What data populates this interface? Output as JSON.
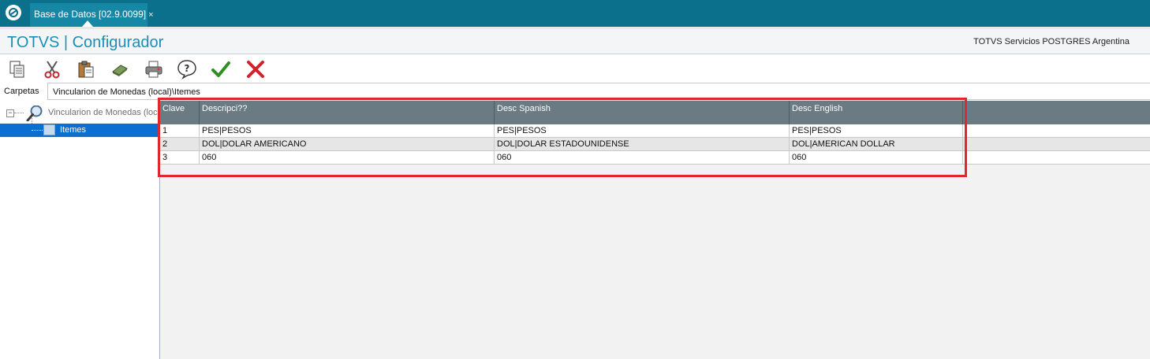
{
  "topbar": {
    "logo_icon": "totvs-logo-icon",
    "tab_label": "Base de Datos [02.9.0099]",
    "tab_close": "×"
  },
  "header": {
    "title": "TOTVS | Configurador",
    "company": "TOTVS Servicios POSTGRES Argentina"
  },
  "toolbar": {
    "buttons": [
      {
        "icon": "copy-icon",
        "glyph": "📄"
      },
      {
        "icon": "cut-icon",
        "glyph": "✂"
      },
      {
        "icon": "paste-icon",
        "glyph": "📋"
      },
      {
        "icon": "eraser-icon",
        "glyph": "▰"
      },
      {
        "icon": "print-icon",
        "glyph": "🖨"
      },
      {
        "icon": "help-icon",
        "glyph": "?"
      },
      {
        "icon": "confirm-icon",
        "glyph": "✔"
      },
      {
        "icon": "cancel-icon",
        "glyph": "✖"
      }
    ]
  },
  "pathbar": {
    "label": "Carpetas",
    "path": "Vincularion de Monedas (local)\\Itemes"
  },
  "tree": {
    "expander": "−",
    "root_label": "Vincularion de Monedas (local)",
    "child_label": "Itemes"
  },
  "grid": {
    "columns": [
      "Clave",
      "Descripci??",
      "Desc Spanish",
      "Desc English"
    ],
    "rows": [
      [
        "1",
        "PES|PESOS",
        "PES|PESOS",
        "PES|PESOS"
      ],
      [
        "2",
        "DOL|DOLAR AMERICANO",
        "DOL|DOLAR ESTADOUNIDENSE",
        "DOL|AMERICAN DOLLAR"
      ],
      [
        "3",
        "060",
        "060",
        "060"
      ]
    ]
  },
  "colors": {
    "topbar": "#0b708b",
    "title": "#1b8fb6",
    "header": "#6b7b83",
    "selection": "#0a6fd0",
    "highlight": "#e2262e"
  }
}
